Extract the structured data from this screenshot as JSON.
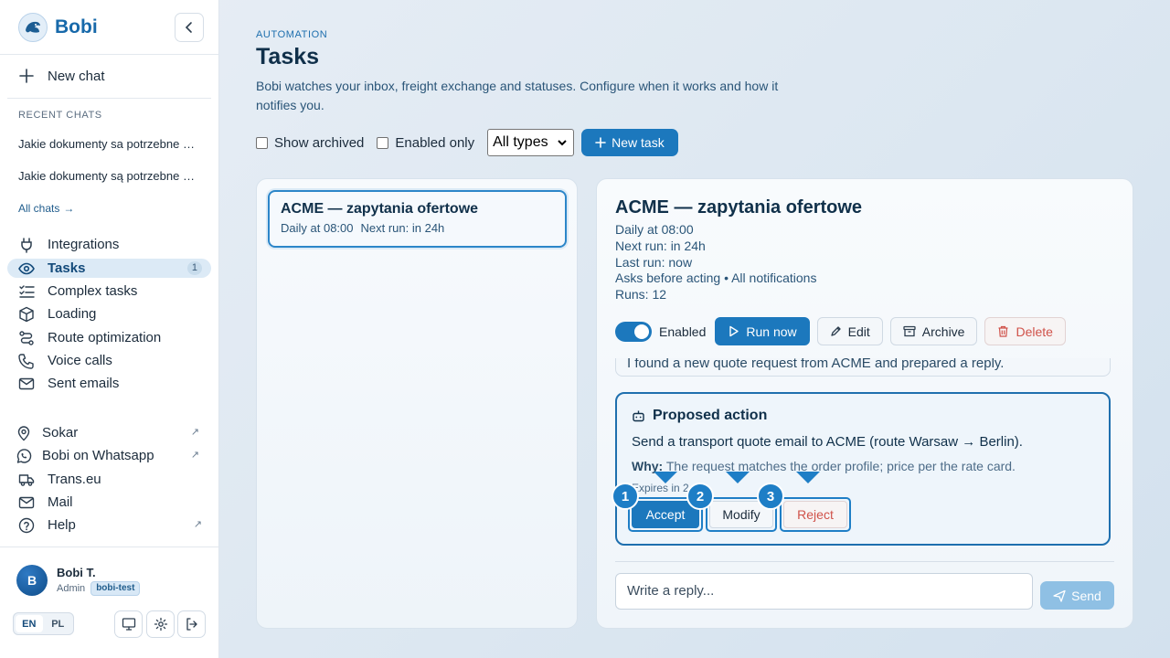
{
  "brand": {
    "name": "Bobi"
  },
  "sidebar": {
    "new_chat": "New chat",
    "recent_label": "RECENT CHATS",
    "recent_chats": [
      "Jakie dokumenty sa potrzebne do przewozu",
      "Jakie dokumenty są potrzebne do przewozu"
    ],
    "all_chats": "All chats",
    "nav": [
      {
        "label": "Integrations",
        "icon": "plug-icon"
      },
      {
        "label": "Tasks",
        "icon": "eye-icon",
        "badge": "1",
        "active": true
      },
      {
        "label": "Complex tasks",
        "icon": "list-checks-icon"
      },
      {
        "label": "Loading",
        "icon": "box-icon"
      },
      {
        "label": "Route optimization",
        "icon": "route-icon"
      },
      {
        "label": "Voice calls",
        "icon": "phone-icon"
      },
      {
        "label": "Sent emails",
        "icon": "mail-icon"
      }
    ],
    "external": [
      {
        "label": "Sokar",
        "icon": "map-pin-icon",
        "external": true
      },
      {
        "label": "Bobi on Whatsapp",
        "icon": "whatsapp-icon",
        "external": true
      },
      {
        "label": "Trans.eu",
        "icon": "truck-icon",
        "external": false
      },
      {
        "label": "Mail",
        "icon": "mail-icon",
        "external": false
      },
      {
        "label": "Help",
        "icon": "help-icon",
        "external": true
      }
    ],
    "user": {
      "initial": "B",
      "name": "Bobi T.",
      "role": "Admin",
      "env": "bobi-test"
    },
    "lang": {
      "en": "EN",
      "pl": "PL",
      "selected": "EN"
    }
  },
  "header": {
    "eyebrow": "AUTOMATION",
    "title": "Tasks",
    "description": "Bobi watches your inbox, freight exchange and statuses. Configure when it works and how it notifies you."
  },
  "filters": {
    "show_archived": "Show archived",
    "enabled_only": "Enabled only",
    "type_select": "All types",
    "new_task": "New task"
  },
  "task_list": [
    {
      "title": "ACME — zapytania ofertowe",
      "schedule": "Daily at 08:00",
      "next_run": "Next run: in 24h"
    }
  ],
  "detail": {
    "title": "ACME — zapytania ofertowe",
    "schedule": "Daily at 08:00",
    "next_run": "Next run: in 24h",
    "last_run": "Last run: now",
    "mode": "Asks before acting",
    "notifications": "All notifications",
    "runs": "Runs: 12",
    "enabled_label": "Enabled",
    "enabled": true,
    "buttons": {
      "run_now": "Run now",
      "edit": "Edit",
      "archive": "Archive",
      "delete": "Delete"
    },
    "feed_message": "I found a new quote request from ACME and prepared a reply.",
    "proposal": {
      "heading": "Proposed action",
      "text": "Send a transport quote email to ACME (route Warsaw → Berlin).",
      "why_label": "Why:",
      "why_text": "The request matches the order profile; price per the rate card.",
      "expires": "Expires in 2",
      "accept": "Accept",
      "modify": "Modify",
      "reject": "Reject"
    },
    "reply_placeholder": "Write a reply...",
    "send": "Send"
  },
  "markers": [
    "1",
    "2",
    "3"
  ],
  "colors": {
    "accent": "#1c78bd",
    "danger": "#d0524a",
    "marker": "#1e7ec6"
  }
}
